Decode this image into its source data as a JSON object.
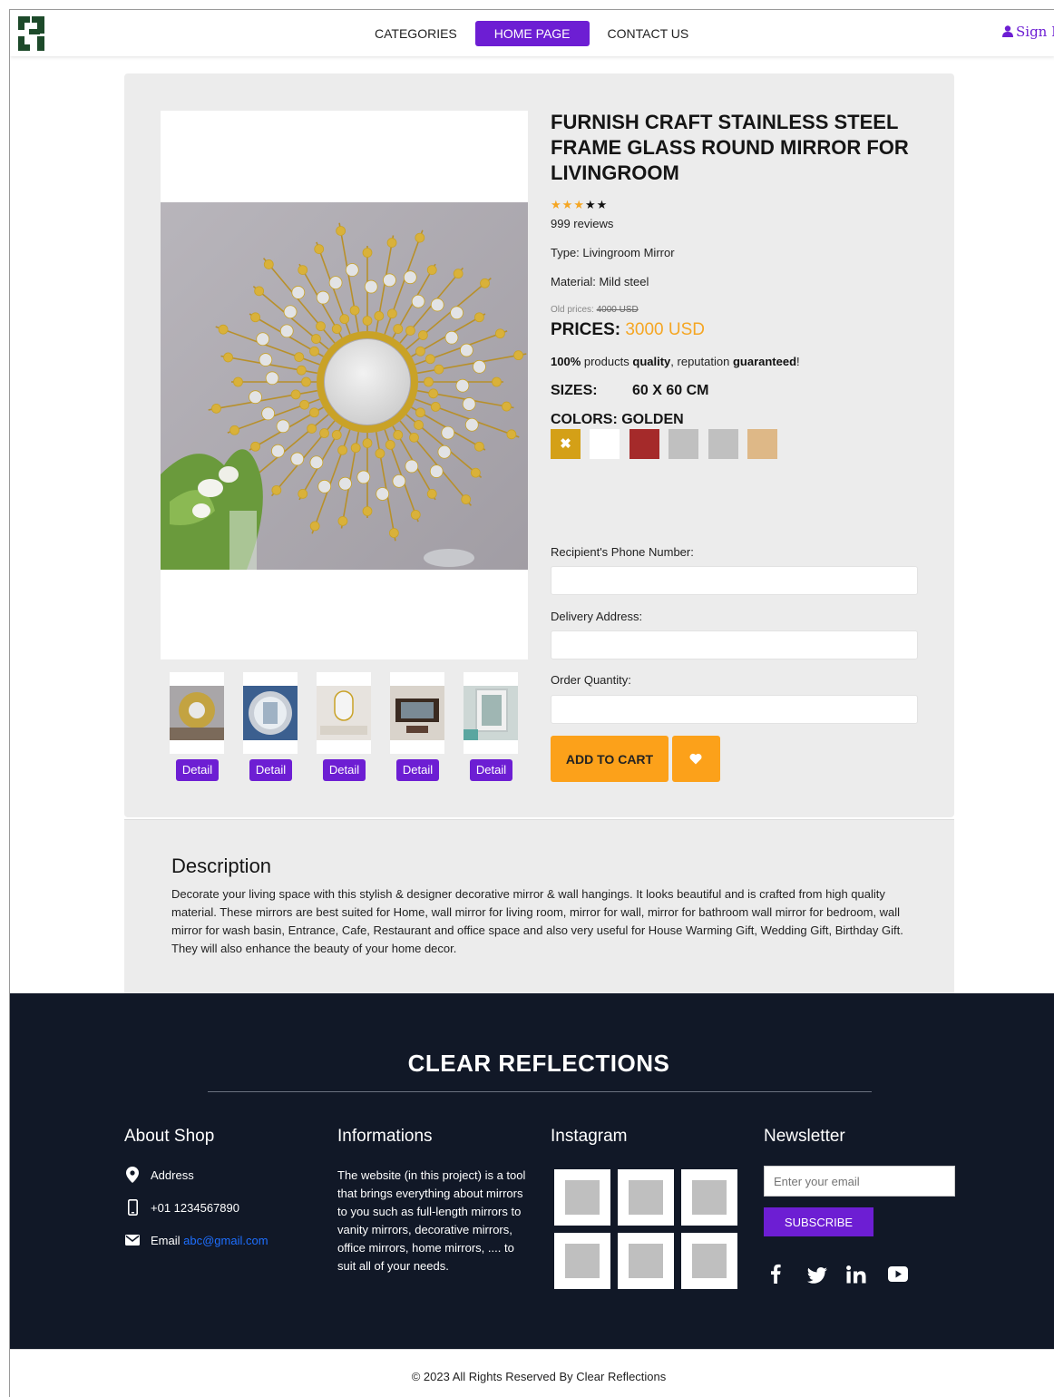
{
  "nav": {
    "items": [
      "CATEGORIES",
      "HOME PAGE",
      "CONTACT US"
    ],
    "signin": "Sign In"
  },
  "product": {
    "title": "FURNISH CRAFT STAINLESS STEEL FRAME GLASS ROUND MIRROR FOR LIVINGROOM",
    "rating": 3,
    "rating_max": 5,
    "reviews": "999 reviews",
    "type": "Type: Livingroom Mirror",
    "material": "Material: Mild steel",
    "old_label": "Old prices:",
    "old_price": "4000 USD",
    "price_label": "PRICES:",
    "price": "3000 USD",
    "quality_pct": "100%",
    "quality_mid1": "products",
    "quality_word": "quality",
    "quality_mid2": ", reputation",
    "quality_end": "guaranteed",
    "quality_bang": "!",
    "sizes_label": "SIZES:",
    "sizes_value": "60 X 60 CM",
    "colors_label": "COLORS: GOLDEN",
    "swatches": [
      "#d4a017",
      "#ffffff",
      "#a52a2a",
      "#c0c0c0",
      "#c0c0c0",
      "#deb887"
    ],
    "selected_swatch_mark": "✖"
  },
  "thumbnails": {
    "detail_label": "Detail",
    "count": 5
  },
  "form": {
    "phone_label": "Recipient's Phone Number:",
    "address_label": "Delivery Address:",
    "qty_label": "Order Quantity:",
    "cart_label": "ADD TO CART"
  },
  "description": {
    "heading": "Description",
    "text": "Decorate your living space with this stylish & designer decorative mirror & wall hangings. It looks beautiful and is crafted from high quality material. These mirrors are best suited for Home, wall mirror for living room, mirror for wall, mirror for bathroom wall mirror for bedroom, wall mirror for wash basin, Entrance, Cafe, Restaurant and office space and also very useful for House Warming Gift, Wedding Gift, Birthday Gift. They will also enhance the beauty of your home decor."
  },
  "footer": {
    "brand": "CLEAR REFLECTIONS",
    "about_heading": "About Shop",
    "address": "Address",
    "phone": "+01 1234567890",
    "email_label": "Email",
    "email": "abc@gmail.com",
    "info_heading": "Informations",
    "info_text": "The website (in this project) is a tool that brings everything about mirrors to you such as full-length mirrors to vanity mirrors, decorative mirrors, office mirrors, home mirrors, .... to suit all of your needs.",
    "instagram_heading": "Instagram",
    "newsletter_heading": "Newsletter",
    "email_placeholder": "Enter your email",
    "subscribe_label": "SUBSCRIBE",
    "social_icons": [
      "facebook-icon",
      "twitter-icon",
      "linkedin-icon",
      "youtube-icon"
    ],
    "copyright": "© 2023 All Rights Reserved By Clear Reflections"
  },
  "colors": {
    "accent": "#6d1ed3",
    "orange": "#fca11a",
    "footer_bg": "#111827",
    "card_bg": "#ececec"
  }
}
